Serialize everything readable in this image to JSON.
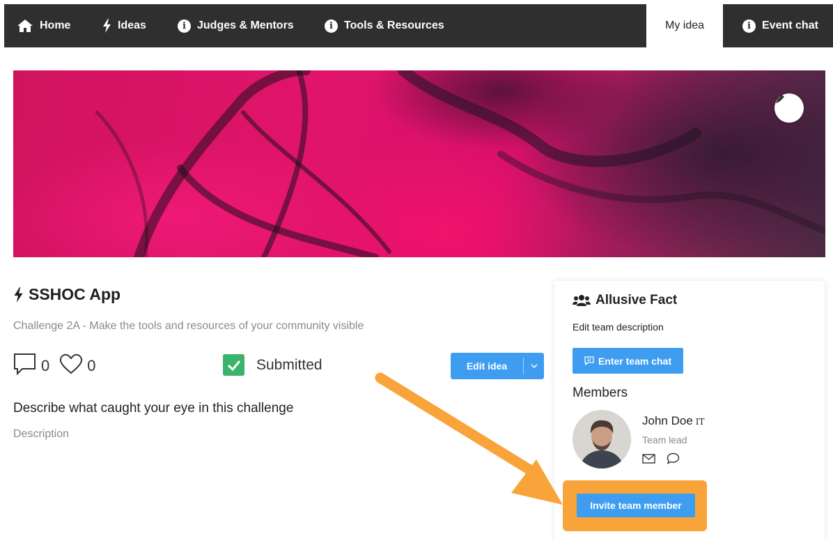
{
  "nav": {
    "items": [
      {
        "label": "Home",
        "icon": "home-icon"
      },
      {
        "label": "Ideas",
        "icon": "bolt-icon"
      },
      {
        "label": "Judges & Mentors",
        "icon": "info-icon"
      },
      {
        "label": "Tools & Resources",
        "icon": "info-icon"
      },
      {
        "label": "My idea",
        "active": true
      },
      {
        "label": "Event chat",
        "icon": "info-icon"
      }
    ]
  },
  "idea": {
    "title": "SSHOC App",
    "challenge": "Challenge 2A - Make the tools and resources of your community visible",
    "comments": "0",
    "likes": "0",
    "status": "Submitted",
    "edit_label": "Edit idea",
    "question": "Describe what caught your eye in this challenge",
    "description": "Description"
  },
  "team": {
    "name": "Allusive Fact",
    "edit_description": "Edit team description",
    "chat_label": "Enter team chat",
    "members_heading": "Members",
    "members": [
      {
        "name": "John Doe",
        "country": "IT",
        "role": "Team lead"
      }
    ],
    "invite_label": "Invite team member"
  },
  "colors": {
    "nav_bg": "#2f2f2f",
    "accent_blue": "#3e9df0",
    "highlight_orange": "#f9a43a",
    "status_green": "#3bb36a",
    "hero_pink": "#e0146a"
  }
}
